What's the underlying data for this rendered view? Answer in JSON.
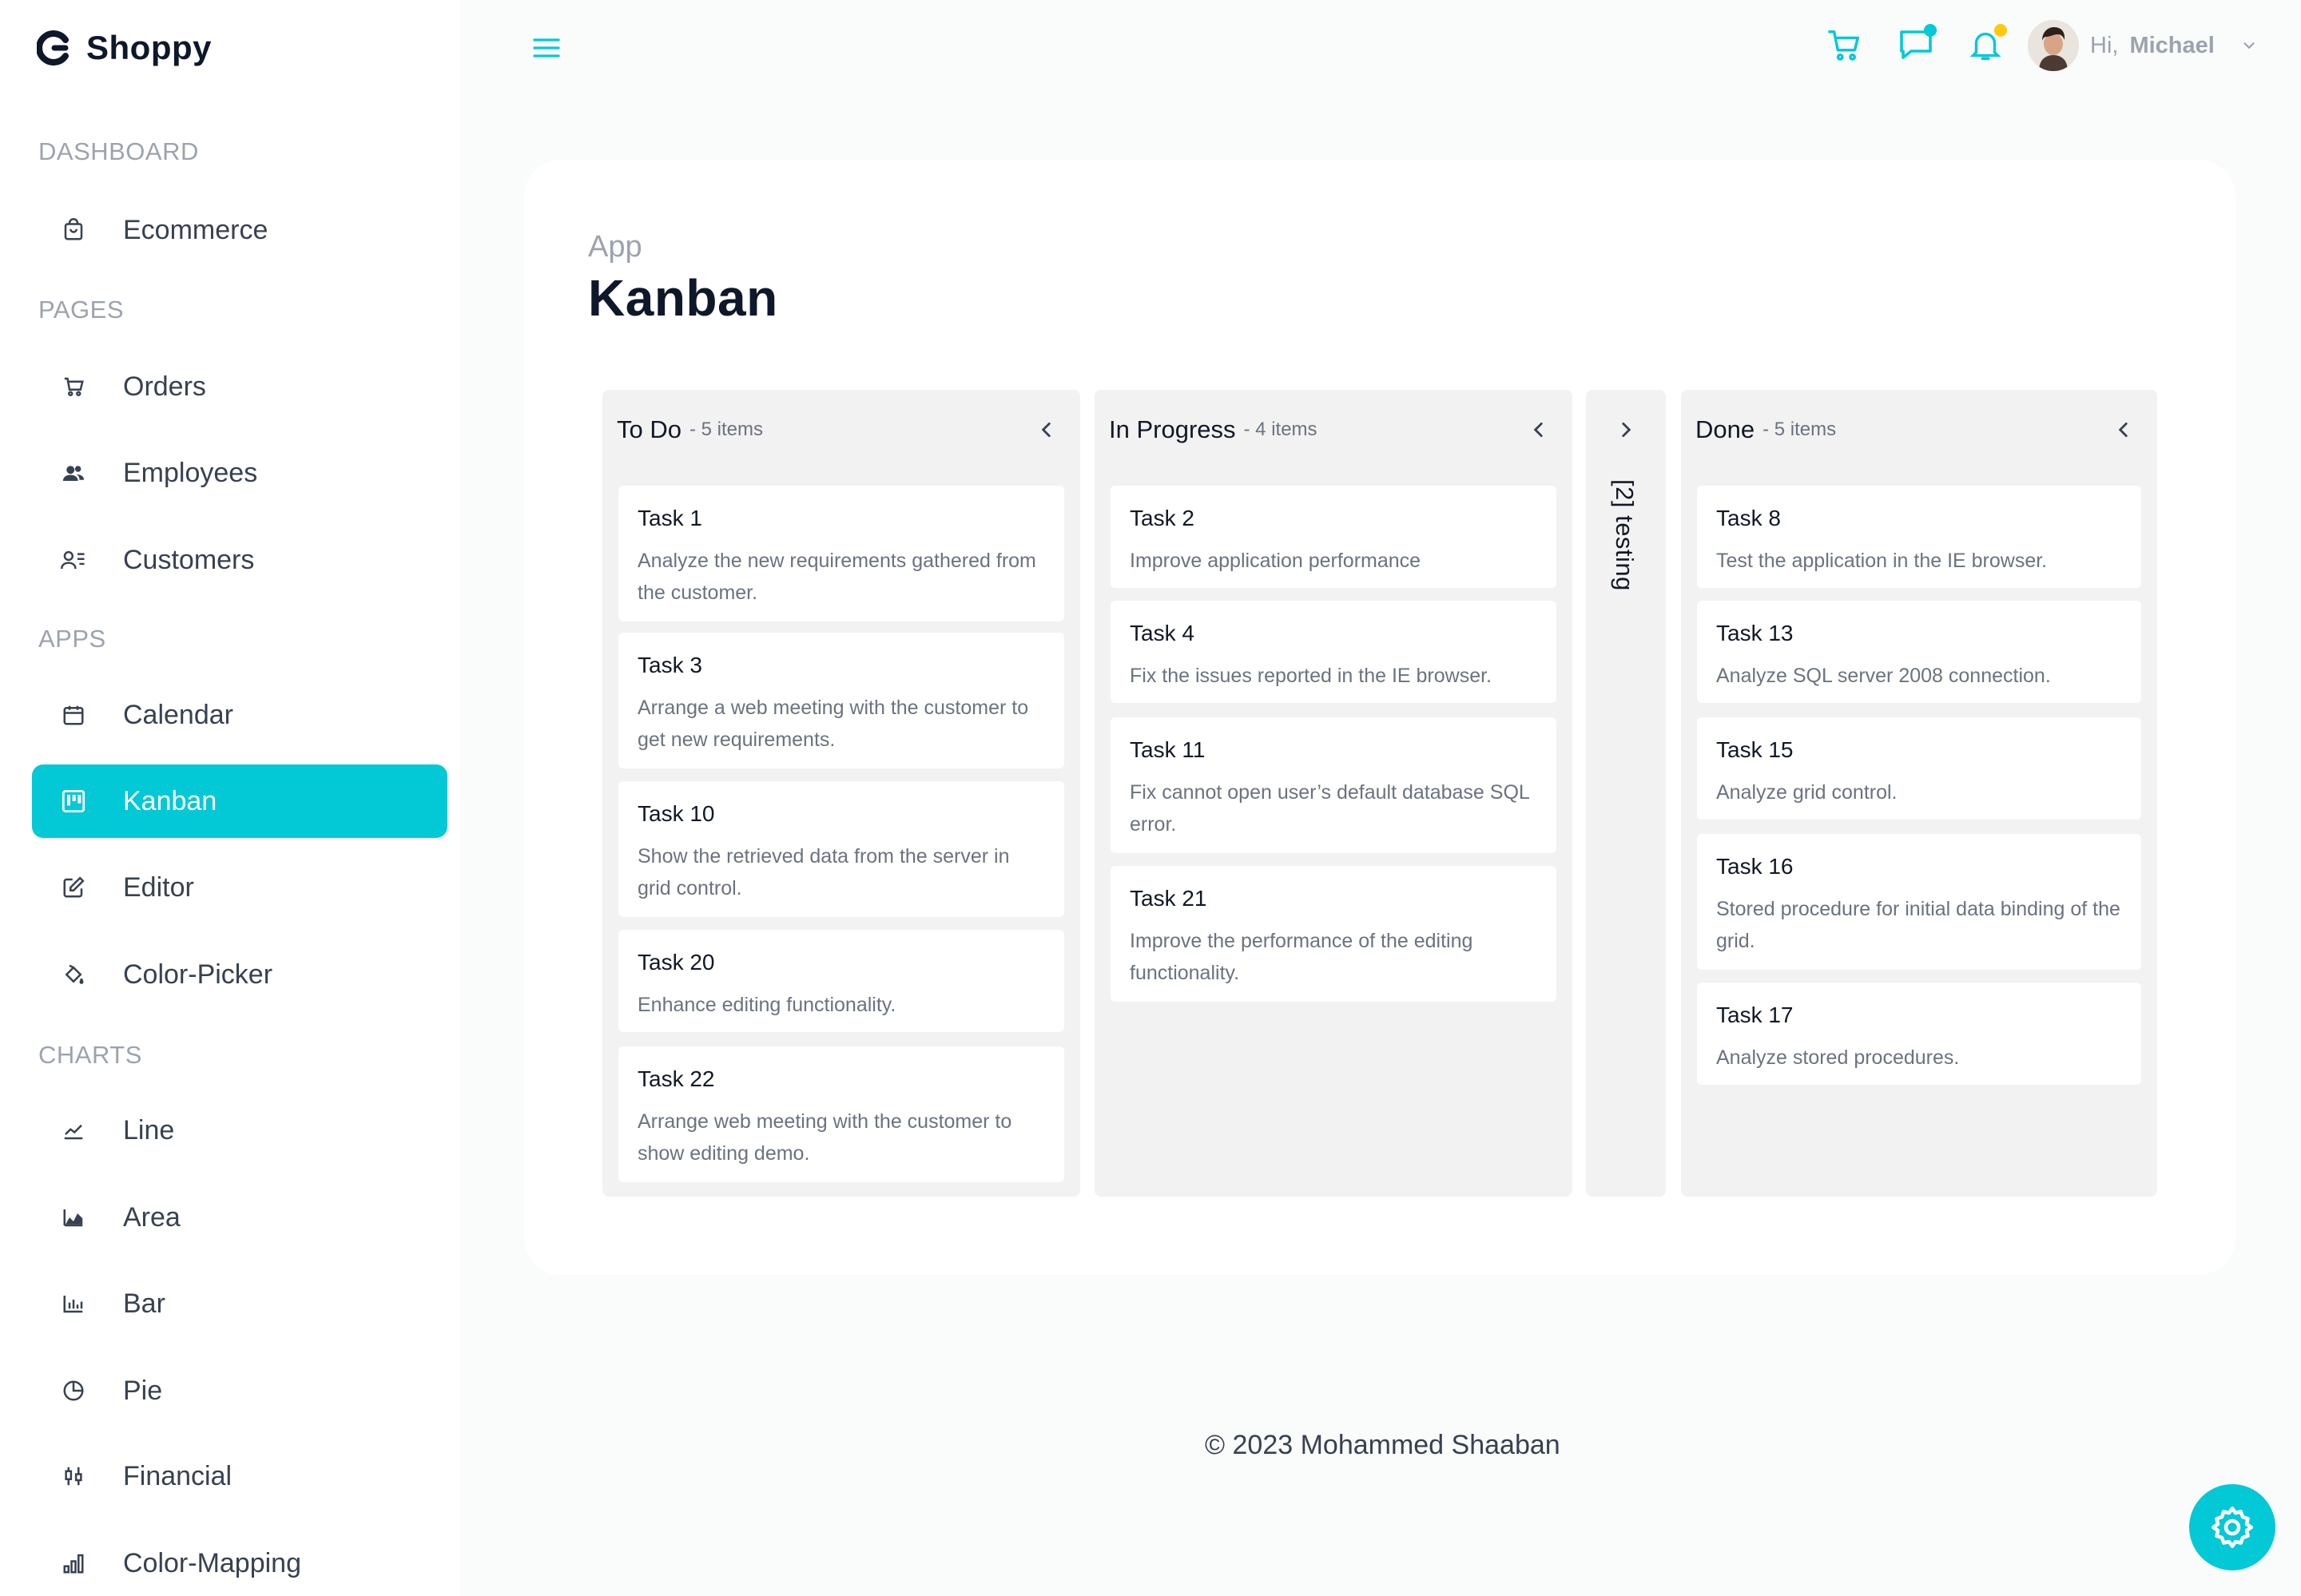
{
  "brand": {
    "name": "Shoppy",
    "icon": "shoppy-logo-icon"
  },
  "sidebar": {
    "sections": [
      {
        "title": "DASHBOARD",
        "items": [
          {
            "label": "Ecommerce",
            "icon": "shopping-bag-icon"
          }
        ]
      },
      {
        "title": "PAGES",
        "items": [
          {
            "label": "Orders",
            "icon": "cart-icon"
          },
          {
            "label": "Employees",
            "icon": "people-icon"
          },
          {
            "label": "Customers",
            "icon": "customers-icon"
          }
        ]
      },
      {
        "title": "APPS",
        "items": [
          {
            "label": "Calendar",
            "icon": "calendar-icon"
          },
          {
            "label": "Kanban",
            "icon": "kanban-icon",
            "active": true
          },
          {
            "label": "Editor",
            "icon": "edit-icon"
          },
          {
            "label": "Color-Picker",
            "icon": "paint-bucket-icon"
          }
        ]
      },
      {
        "title": "CHARTS",
        "items": [
          {
            "label": "Line",
            "icon": "line-chart-icon"
          },
          {
            "label": "Area",
            "icon": "area-chart-icon"
          },
          {
            "label": "Bar",
            "icon": "bar-chart-icon"
          },
          {
            "label": "Pie",
            "icon": "pie-chart-icon"
          },
          {
            "label": "Financial",
            "icon": "stock-icon"
          },
          {
            "label": "Color-Mapping",
            "icon": "color-mapping-icon"
          }
        ]
      }
    ]
  },
  "header": {
    "greeting": "Hi,",
    "user_name": "Michael",
    "icons": [
      "menu-icon",
      "cart-icon",
      "chat-icon",
      "bell-icon",
      "chevron-down-icon"
    ],
    "badge_colors": {
      "chat": "#03c9d7",
      "notification": "#fec90f"
    }
  },
  "page": {
    "breadcrumb": "App",
    "title": "Kanban"
  },
  "kanban": {
    "columns": [
      {
        "name": "To Do",
        "count": "- 5 items",
        "cards": [
          {
            "title": "Task 1",
            "desc": "Analyze the new requirements gathered from the customer."
          },
          {
            "title": "Task 3",
            "desc": "Arrange a web meeting with the customer to get new requirements."
          },
          {
            "title": "Task 10",
            "desc": "Show the retrieved data from the server in grid control."
          },
          {
            "title": "Task 20",
            "desc": "Enhance editing functionality."
          },
          {
            "title": "Task 22",
            "desc": "Arrange web meeting with the customer to show editing demo."
          }
        ]
      },
      {
        "name": "In Progress",
        "count": "- 4 items",
        "cards": [
          {
            "title": "Task 2",
            "desc": "Improve application performance"
          },
          {
            "title": "Task 4",
            "desc": "Fix the issues reported in the IE browser."
          },
          {
            "title": "Task 11",
            "desc": "Fix cannot open user’s default database SQL error."
          },
          {
            "title": "Task 21",
            "desc": "Improve the performance of the editing functionality."
          }
        ]
      },
      {
        "name": "Done",
        "count": "- 5 items",
        "cards": [
          {
            "title": "Task 8",
            "desc": "Test the application in the IE browser."
          },
          {
            "title": "Task 13",
            "desc": "Analyze SQL server 2008 connection."
          },
          {
            "title": "Task 15",
            "desc": "Analyze grid control."
          },
          {
            "title": "Task 16",
            "desc": "Stored procedure for initial data binding of the grid."
          },
          {
            "title": "Task 17",
            "desc": "Analyze stored procedures."
          }
        ]
      }
    ],
    "collapsed_column": {
      "label": "[2] testing"
    }
  },
  "footer": {
    "text": "© 2023 Mohammed Shaaban"
  },
  "settings": {
    "icon": "gear-icon"
  },
  "colors": {
    "accent": "#03c9d7"
  }
}
